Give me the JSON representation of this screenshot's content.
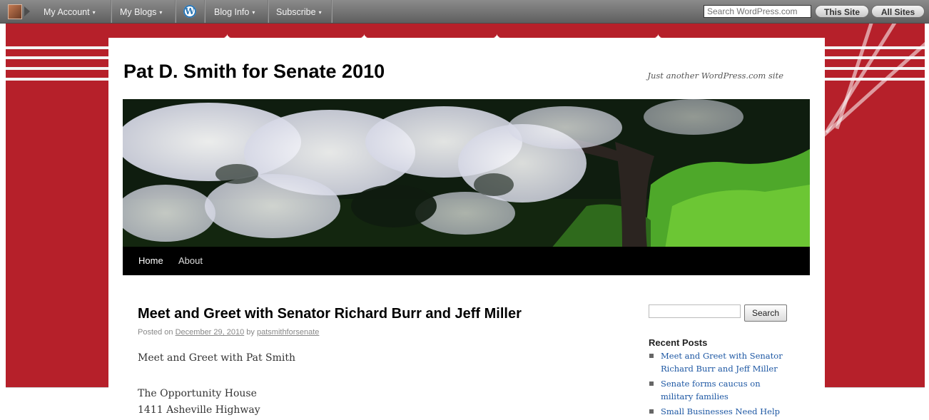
{
  "adminbar": {
    "my_account": "My Account",
    "my_blogs": "My Blogs",
    "blog_info": "Blog Info",
    "subscribe": "Subscribe",
    "caret": "▾",
    "wp_logo": "W",
    "search_placeholder": "Search WordPress.com",
    "this_site": "This Site",
    "all_sites": "All Sites",
    "icons": [
      "avatar-icon",
      "wordpress-logo-icon"
    ]
  },
  "site": {
    "title": "Pat D. Smith for Senate 2010",
    "tagline": "Just another WordPress.com site"
  },
  "nav": {
    "home": "Home",
    "about": "About"
  },
  "post": {
    "title": "Meet and Greet with Senator Richard Burr and Jeff Miller",
    "posted_on": "Posted on",
    "date": "December 29, 2010",
    "by": "by",
    "author": "patsmithforsenate",
    "paragraphs": [
      "Meet and Greet with Pat Smith",
      "The Opportunity House",
      "1411 Asheville Highway"
    ]
  },
  "sidebar": {
    "search_button": "Search",
    "recent_heading": "Recent Posts",
    "recent_posts": [
      "Meet and Greet with Senator Richard Burr and Jeff Miller",
      "Senate forms caucus on military families",
      "Small Businesses Need Help"
    ]
  },
  "colors": {
    "background_red": "#b6202a",
    "adminbar": "#6f6f6f",
    "nav_bar": "#000000",
    "link_blue": "#1d57a3"
  }
}
